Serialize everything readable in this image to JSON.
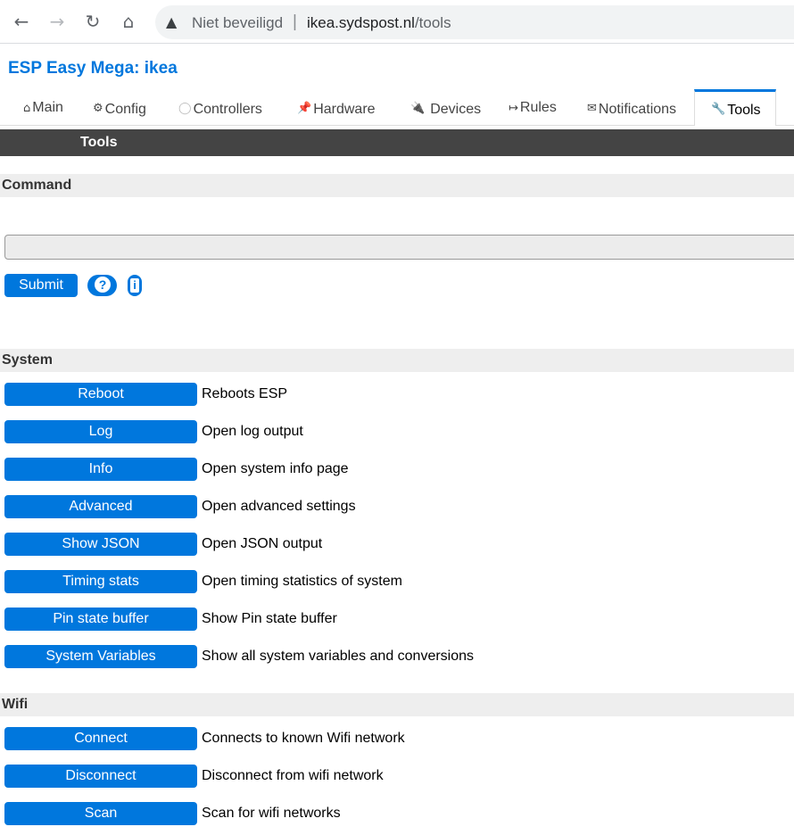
{
  "browser": {
    "security_label": "Niet beveiligd",
    "separator": "|",
    "url_host": "ikea.sydspost.nl",
    "url_path": "/tools",
    "back_icon": "←",
    "forward_icon": "→",
    "reload_icon": "↻",
    "home_icon": "⌂",
    "warning_icon": "▲"
  },
  "app": {
    "title": "ESP Easy Mega: ikea"
  },
  "menu": {
    "tabs": [
      {
        "icon": "⌂",
        "label": "Main"
      },
      {
        "icon": "⚙",
        "label": "Config"
      },
      {
        "icon": "◯",
        "label": "Controllers"
      },
      {
        "icon": "📌",
        "label": "Hardware"
      },
      {
        "icon": "🔌",
        "label": "Devices"
      },
      {
        "icon": "↦",
        "label": "Rules"
      },
      {
        "icon": "✉",
        "label": "Notifications"
      },
      {
        "icon": "🔧",
        "label": "Tools"
      }
    ],
    "active_tab": "Tools"
  },
  "page": {
    "header": "Tools",
    "command_section": "Command",
    "command_value": "",
    "submit_label": "Submit",
    "help_glyph": "?",
    "info_glyph": "i",
    "system_section": "System",
    "wifi_section": "Wifi"
  },
  "system_rows": [
    {
      "button": "Reboot",
      "desc": "Reboots ESP"
    },
    {
      "button": "Log",
      "desc": "Open log output"
    },
    {
      "button": "Info",
      "desc": "Open system info page"
    },
    {
      "button": "Advanced",
      "desc": "Open advanced settings"
    },
    {
      "button": "Show JSON",
      "desc": "Open JSON output"
    },
    {
      "button": "Timing stats",
      "desc": "Open timing statistics of system"
    },
    {
      "button": "Pin state buffer",
      "desc": "Show Pin state buffer"
    },
    {
      "button": "System Variables",
      "desc": "Show all system variables and conversions"
    }
  ],
  "wifi_rows": [
    {
      "button": "Connect",
      "desc": "Connects to known Wifi network"
    },
    {
      "button": "Disconnect",
      "desc": "Disconnect from wifi network"
    },
    {
      "button": "Scan",
      "desc": "Scan for wifi networks"
    }
  ],
  "colors": {
    "accent": "#0077dd",
    "header_bar": "#444444",
    "section_bg": "#eeeeee"
  }
}
